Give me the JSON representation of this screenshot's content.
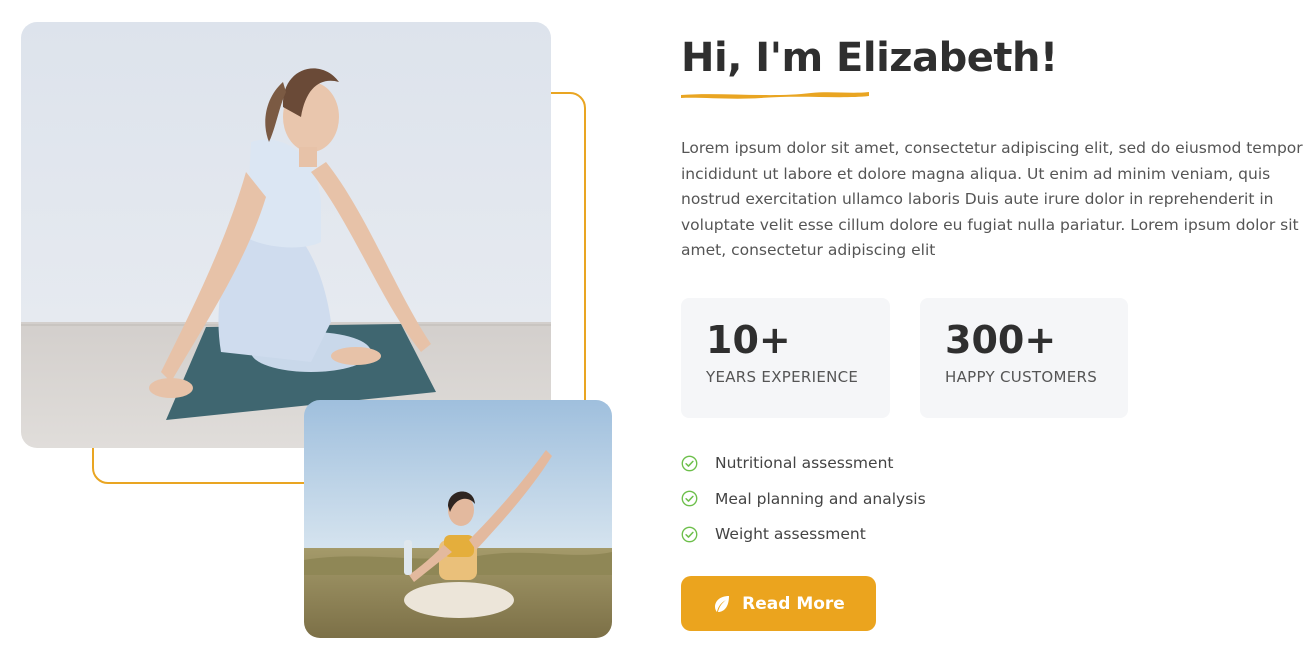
{
  "about": {
    "heading": "Hi, I'm Elizabeth!",
    "intro": "Lorem ipsum dolor sit amet, consectetur adipiscing elit, sed do eiusmod tempor incididunt ut labore et dolore magna aliqua. Ut enim ad minim veniam, quis nostrud exercitation ullamco laboris Duis aute irure dolor in reprehenderit in voluptate velit esse cillum dolore eu fugiat nulla pariatur. Lorem ipsum dolor sit amet, consectetur adipiscing elit"
  },
  "stats": [
    {
      "number": "10+",
      "label": "YEARS EXPERIENCE"
    },
    {
      "number": "300+",
      "label": "HAPPY CUSTOMERS"
    }
  ],
  "features": [
    {
      "icon": "check-circle-icon",
      "text": "Nutritional assessment"
    },
    {
      "icon": "check-circle-icon",
      "text": "Meal planning and analysis"
    },
    {
      "icon": "check-circle-icon",
      "text": "Weight assessment"
    }
  ],
  "cta": {
    "icon": "leaf-icon",
    "label": "Read More"
  },
  "colors": {
    "accent": "#eba41e",
    "check": "#6dbf4b",
    "heading": "#2f2f2f",
    "stat_bg": "#f5f6f8"
  },
  "images": {
    "main": "woman-yoga-twist-on-mat",
    "secondary": "woman-stretching-in-field"
  }
}
